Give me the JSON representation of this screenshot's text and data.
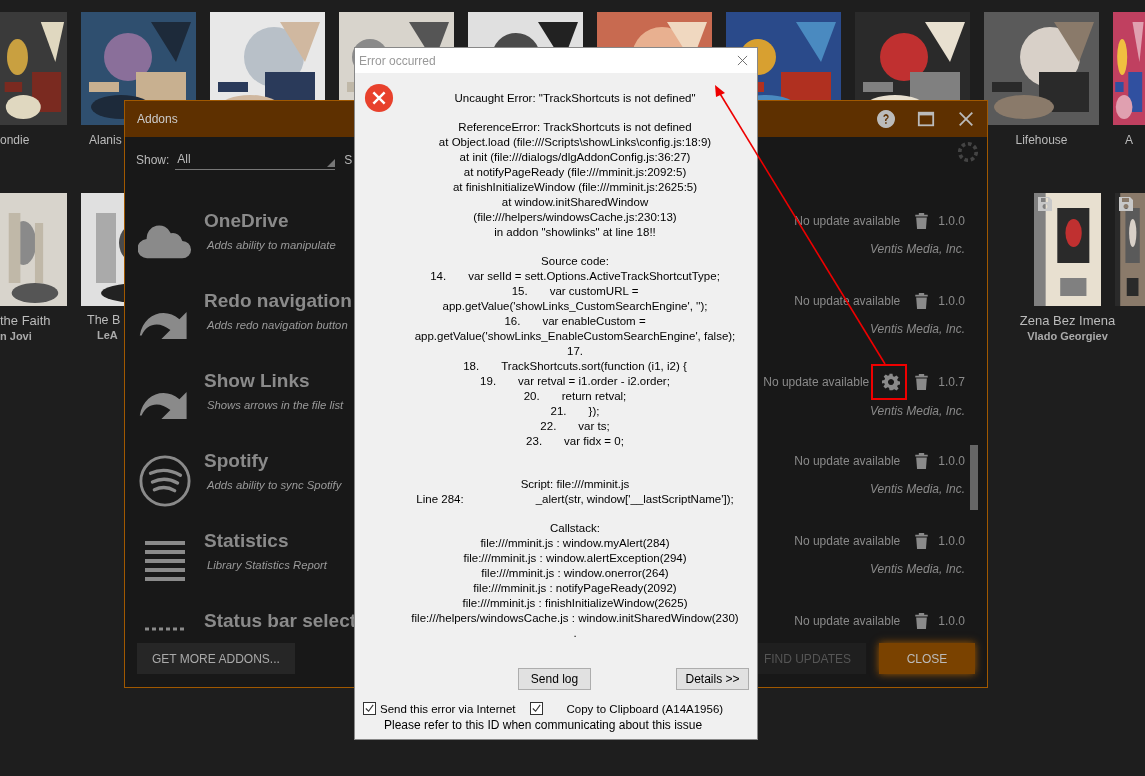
{
  "albums": {
    "top_row": [
      {
        "kind": "picture",
        "title": "ondie"
      },
      {
        "kind": "picture",
        "title": "Alanis"
      },
      {
        "kind": "picture"
      },
      {
        "kind": "picture"
      },
      {
        "kind": "picture"
      },
      {
        "kind": "picture"
      },
      {
        "kind": "picture"
      },
      {
        "kind": "picture"
      },
      {
        "kind": "picture",
        "title": "Lifehouse"
      },
      {
        "kind": "picture",
        "title": "A"
      }
    ],
    "second_row_left": [
      {
        "kind": "picture",
        "title": "the Faith",
        "artist": "n Jovi"
      },
      {
        "kind": "picture",
        "title": "The B",
        "artist": "LeA"
      }
    ],
    "second_row_right": [
      {
        "kind": "picture",
        "title": "Zena Bez Imena",
        "artist": "Vlado Georgiev",
        "saved": true
      },
      {
        "kind": "picture",
        "saved": true
      }
    ]
  },
  "addons_window": {
    "title": "Addons",
    "show_label": "Show:",
    "show_value": "All",
    "label_2": "S",
    "addons": [
      {
        "kind": "cloud",
        "name": "OneDrive",
        "description": "Adds ability to manipulate",
        "status": "No update available",
        "has_settings": false,
        "version": "1.0.0",
        "publisher": "Ventis Media, Inc."
      },
      {
        "kind": "arrow",
        "name": "Redo navigation",
        "description": "Adds redo navigation button",
        "status": "No update available",
        "has_settings": false,
        "version": "1.0.0",
        "publisher": "Ventis Media, Inc."
      },
      {
        "kind": "arrow",
        "name": "Show Links",
        "description": "Shows arrows in the file list",
        "status": "No update available",
        "has_settings": true,
        "version": "1.0.7",
        "publisher": "Ventis Media, Inc."
      },
      {
        "kind": "spotify",
        "name": "Spotify",
        "description": "Adds ability to sync Spotify",
        "status": "No update available",
        "has_settings": false,
        "version": "1.0.0",
        "publisher": "Ventis Media, Inc."
      },
      {
        "kind": "lines",
        "name": "Statistics",
        "description": "Library Statistics Report",
        "status": "No update available",
        "has_settings": false,
        "version": "1.0.0",
        "publisher": "Ventis Media, Inc."
      },
      {
        "kind": "dashes",
        "name": "Status bar select",
        "status": "No update available",
        "has_settings": false,
        "version": "1.0.0"
      }
    ],
    "buttons": [
      {
        "label": "GET MORE ADDONS...",
        "kind": "secondary",
        "disabled": false
      },
      {
        "label": "FIND UPDATES",
        "kind": "secondary",
        "disabled": true
      },
      {
        "label": "CLOSE",
        "kind": "primary",
        "disabled": false
      }
    ]
  },
  "error_dialog": {
    "title": "Error occurred",
    "message": "Uncaught Error: \"TrackShortcuts is not defined\"",
    "trace": [
      "ReferenceError: TrackShortcuts is not defined",
      "at Object.load (file:///Scripts\\showLinks\\config.js:18:9)",
      "at init (file:///dialogs/dlgAddonConfig.js:36:27)",
      "at notifyPageReady (file:///mminit.js:2092:5)",
      "at finishInitializeWindow (file:///mminit.js:2625:5)",
      "at window.initSharedWindow",
      "(file:///helpers/windowsCache.js:230:13)",
      "in addon \"showlinks\" at line 18!!"
    ],
    "source_heading": "Source code:",
    "source_lines": [
      {
        "number": "14.",
        "code": "var selId = sett.Options.ActiveTrackShortcutType;"
      },
      {
        "number": "15.",
        "code": "var customURL ="
      },
      {
        "code": "app.getValue('showLinks_CustomSearchEngine', '');"
      },
      {
        "number": "16.",
        "code": "var enableCustom ="
      },
      {
        "code": "app.getValue('showLinks_EnableCustomSearchEngine', false);"
      },
      {
        "number": "17."
      },
      {
        "number": "18.",
        "code": "TrackShortcuts.sort(function (i1, i2) {"
      },
      {
        "number": "19.",
        "code": "var retval = i1.order - i2.order;"
      },
      {
        "number": "20.",
        "code": "return retval;"
      },
      {
        "number": "21.",
        "code": "});"
      },
      {
        "number": "22.",
        "code": "var ts;"
      },
      {
        "number": "23.",
        "code": "var fidx = 0;"
      }
    ],
    "script": "Script: file:///mminit.js",
    "script_line": {
      "label": "Line 284:",
      "code": "_alert(str, window['__lastScriptName']);"
    },
    "callstack_heading": "Callstack:",
    "callstack": [
      "file:///mminit.js : window.myAlert(284)",
      "file:///mminit.js : window.alertException(294)",
      "file:///mminit.js : window.onerror(264)",
      "file:///mminit.js : notifyPageReady(2092)",
      "file:///mminit.js : finishInitializeWindow(2625)",
      "file:///helpers/windowsCache.js : window.initSharedWindow(230)",
      "."
    ],
    "buttons": [
      "Send log",
      "Details >>"
    ],
    "send_error": {
      "label": "Send this error via Internet",
      "checked": true
    },
    "copy_clipboard": {
      "label": "Copy to Clipboard (A14A1956)",
      "checked": true
    },
    "note": "Please refer to this ID when communicating about this issue"
  }
}
